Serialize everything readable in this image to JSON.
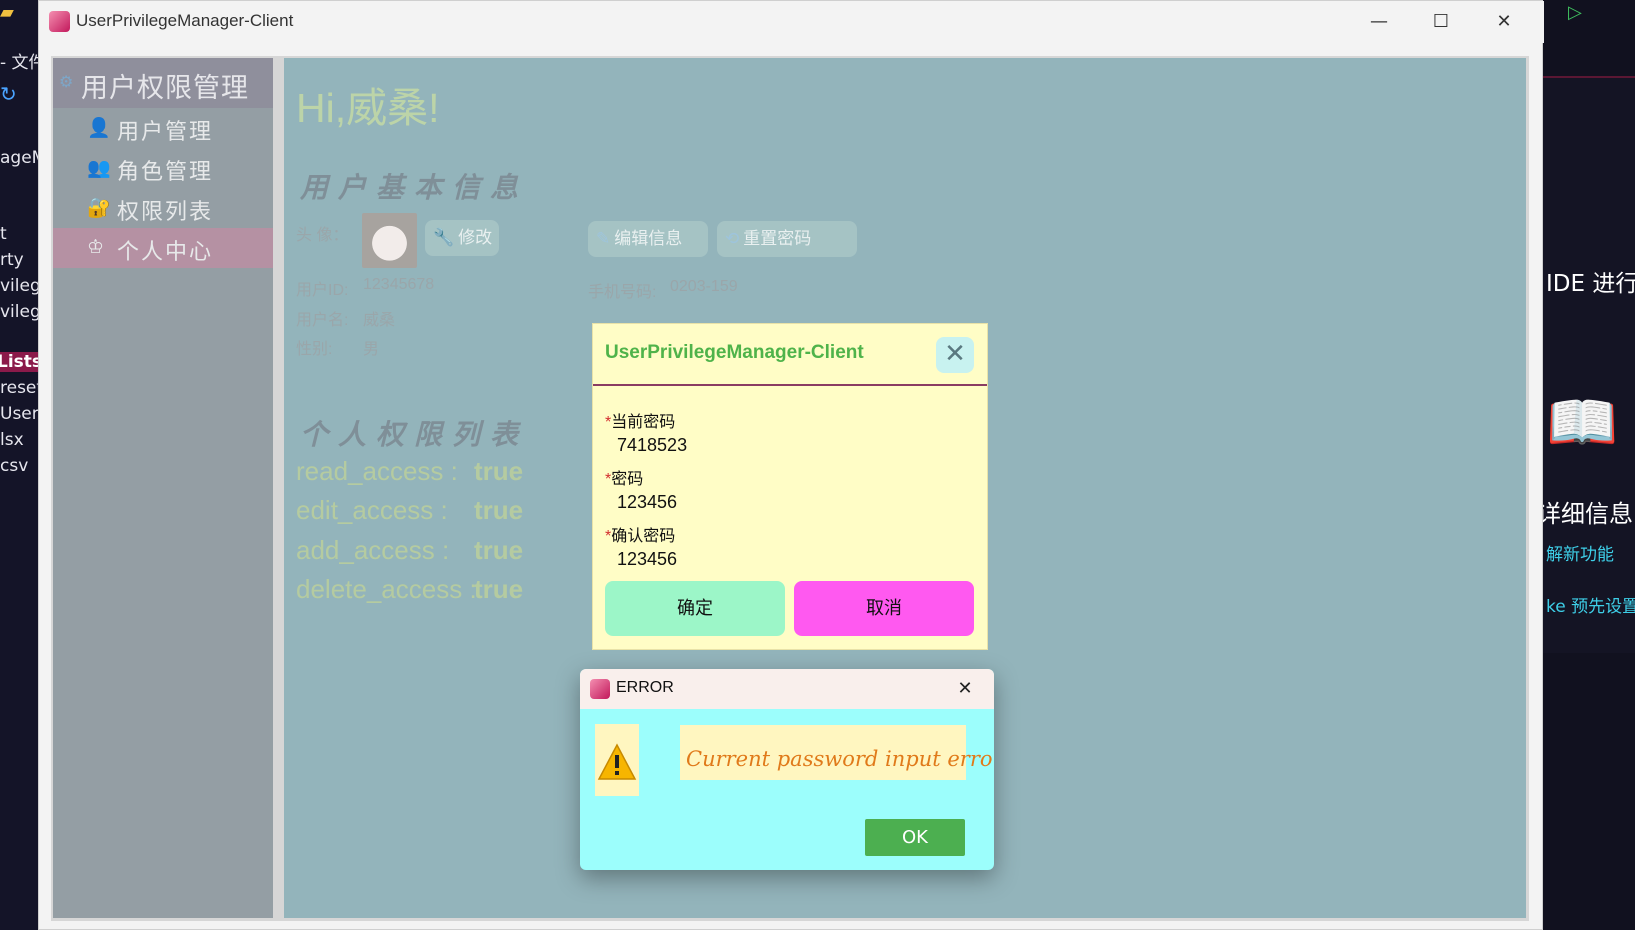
{
  "background_ide": {
    "left_lines": [
      "- 文件",
      "ageM",
      "t",
      "rty",
      "vilege",
      "vilege",
      "Lists.",
      "reset",
      "UserP",
      "lsx",
      "csv"
    ],
    "right_lines": [
      "IDE 进行",
      "详细信息",
      "解新功能",
      "ke 预先设置"
    ]
  },
  "window": {
    "title": "UserPrivilegeManager-Client",
    "controls": {
      "minimize": "—",
      "maximize": "☐",
      "close": "✕"
    }
  },
  "sidebar": {
    "header": "用户权限管理",
    "items": [
      {
        "label": "用户管理",
        "icon": "👤",
        "active": false
      },
      {
        "label": "角色管理",
        "icon": "👥",
        "active": false
      },
      {
        "label": "权限列表",
        "icon": "🔐",
        "active": false
      },
      {
        "label": "个人中心",
        "icon": "♔",
        "active": true
      }
    ]
  },
  "main": {
    "greeting": "Hi,威桑!",
    "basic_info_title": "用户基本信息",
    "avatar_label": "头 像：",
    "modify_button": "修改",
    "edit_info_button": "编辑信息",
    "reset_password_button": "重置密码",
    "fields": {
      "user_id_label": "用户ID:",
      "user_id": "12345678",
      "username_label": "用户名:",
      "username": "威桑",
      "gender_label": "性别:",
      "gender": "男",
      "phone_label": "手机号码:",
      "phone": "0203-159"
    },
    "permissions_title": "个人权限列表",
    "permissions": [
      {
        "key": "read_access :",
        "value": "true"
      },
      {
        "key": "edit_access :",
        "value": "true"
      },
      {
        "key": "add_access :",
        "value": "true"
      },
      {
        "key": "delete_access :",
        "value": "true"
      }
    ]
  },
  "password_dialog": {
    "title": "UserPrivilegeManager-Client",
    "required_mark": "*",
    "current_label": "当前密码",
    "current_value": "7418523",
    "new_label": "密码",
    "new_value": "123456",
    "confirm_label": "确认密码",
    "confirm_value": "123456",
    "ok_label": "确定",
    "cancel_label": "取消"
  },
  "error_dialog": {
    "title": "ERROR",
    "message": "Current password input error !",
    "ok_label": "OK"
  }
}
